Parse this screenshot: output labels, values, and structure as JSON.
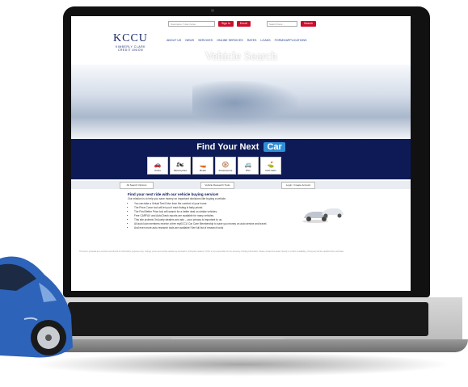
{
  "site": {
    "login": {
      "username_placeholder": "Username / User name",
      "sign_in": "Sign In",
      "enroll": "Enroll"
    },
    "search": {
      "placeholder": "Search here...",
      "button": "Search"
    },
    "logo": {
      "main": "KCCU",
      "sub1": "KIMBERLY CLARK",
      "sub2": "CREDIT UNION"
    },
    "nav": [
      "ABOUT US",
      "NEWS",
      "SERVICES",
      "ONLINE SERVICES",
      "RATES",
      "LOANS",
      "FORMS/APPLICATIONS"
    ],
    "hero_title": "Vehicle Search",
    "band": {
      "title": "Find Your Next",
      "pill": "Car"
    },
    "categories": [
      {
        "label": "Autos",
        "icon": "car-icon"
      },
      {
        "label": "Motorcycles",
        "icon": "motorcycle-icon"
      },
      {
        "label": "Boats",
        "icon": "boat-icon"
      },
      {
        "label": "Powersports",
        "icon": "atv-icon"
      },
      {
        "label": "RVs",
        "icon": "rv-icon"
      },
      {
        "label": "Golf Carts",
        "icon": "golf-cart-icon"
      }
    ],
    "subbuttons": [
      "All Search Options",
      "Vehicle Research Tools",
      "Login / Create Account"
    ],
    "content": {
      "heading": "Find your next ride with our vehicle buying service!",
      "intro": "Our mission is to help you save money on important decisions like buying a vehicle.",
      "bullets": [
        "You can take a Virtual Test Drive from the comfort of your home.",
        "The Price Curve tool will let you if each listing is fairly priced.",
        "The Find Better Price tool will search for a better deal on similar vehicles.",
        "Free CARFAX and AutoCheck reports are available for many vehicles.",
        "This site protects 3rd party stealers and ads -- your privacy is important to us.",
        "All auto loan members receive a free myKCCU Car Care Membership to save you money on auto service and travel.",
        "And even more auto research tools are available! See full list of research tools"
      ]
    },
    "footer": "This site is provided as a member benefit and for information purposes only. Listings, prices and vehicle details are provided by third-party dealers. KCCU is not responsible for the accuracy of listing information. Please contact the dealer directly to confirm availability, pricing and vehicle details before purchase."
  },
  "colors": {
    "navy": "#0d1a55",
    "red": "#c8102e",
    "blue": "#2f8fd6",
    "car_blue": "#2d63b8"
  }
}
